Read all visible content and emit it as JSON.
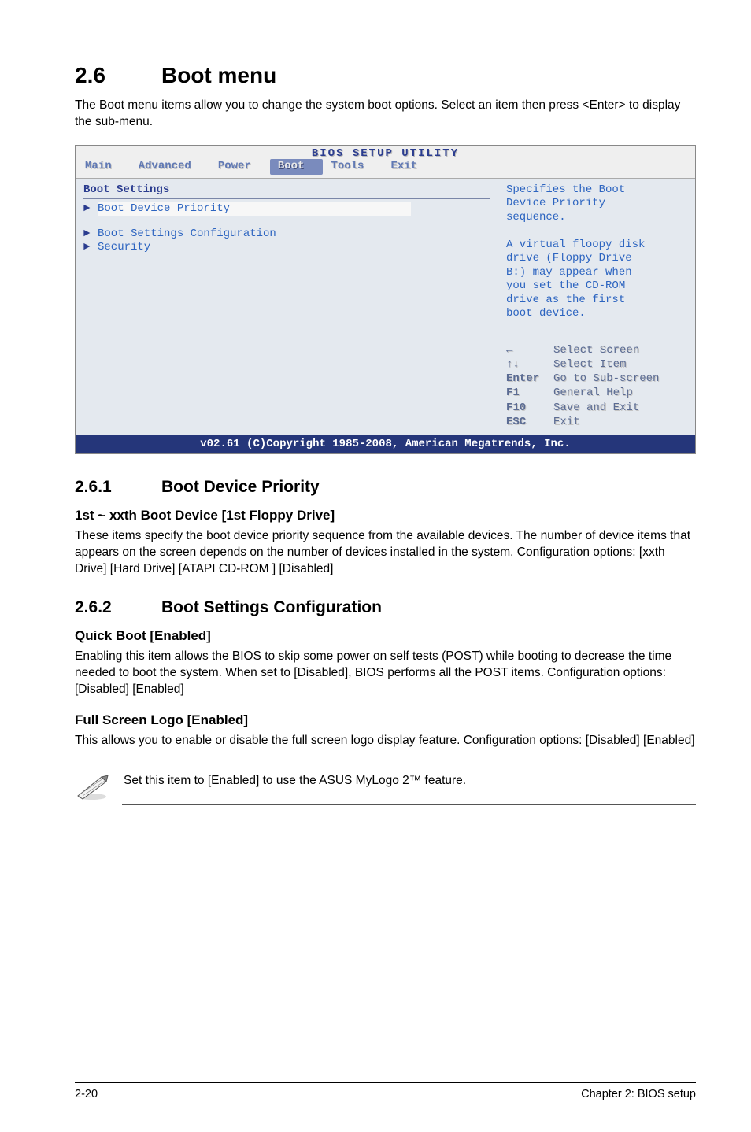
{
  "section": {
    "number": "2.6",
    "title": "Boot menu",
    "intro": "The Boot menu items allow you to change the system boot options. Select an item then press <Enter> to display the sub-menu."
  },
  "bios": {
    "utility_title": "BIOS SETUP UTILITY",
    "tabs": {
      "main": "Main",
      "advanced": "Advanced",
      "power": "Power",
      "boot": "Boot",
      "tools": "Tools",
      "exit": "Exit"
    },
    "left_heading": "Boot Settings",
    "items": {
      "boot_device_priority": "Boot Device Priority",
      "boot_settings_config": "Boot Settings Configuration",
      "security": "Security"
    },
    "help": {
      "line1": "Specifies the Boot",
      "line2": "Device Priority",
      "line3": "sequence.",
      "blank": "",
      "line4": "A virtual floopy disk",
      "line5": "drive (Floppy Drive",
      "line6": "B:) may appear when",
      "line7": "you set the CD-ROM",
      "line8": "drive as the first",
      "line9": "boot device."
    },
    "nav": {
      "select_screen_key": "←",
      "select_screen": "Select Screen",
      "select_item_key": "↑↓",
      "select_item": "Select Item",
      "enter_key": "Enter",
      "enter": "Go to Sub-screen",
      "f1_key": "F1",
      "f1": "General Help",
      "f10_key": "F10",
      "f10": "Save and Exit",
      "esc_key": "ESC",
      "esc": "Exit"
    },
    "footer": "v02.61 (C)Copyright 1985-2008, American Megatrends, Inc."
  },
  "sub_261": {
    "number": "2.6.1",
    "title": "Boot Device Priority",
    "opt1_title": "1st ~ xxth Boot Device [1st Floppy Drive]",
    "opt1_body": "These items specify the boot device priority sequence from the available devices. The number of device items that appears on the screen depends on the number of devices installed in the system. Configuration options: [xxth Drive] [Hard Drive] [ATAPI CD-ROM  ] [Disabled]"
  },
  "sub_262": {
    "number": "2.6.2",
    "title": "Boot Settings Configuration",
    "opt1_title": "Quick Boot [Enabled]",
    "opt1_body": "Enabling this item allows the BIOS to skip some power on self tests (POST) while booting to decrease the time needed to boot the system. When set to [Disabled], BIOS performs all the POST items. Configuration options: [Disabled] [Enabled]",
    "opt2_title": "Full Screen Logo [Enabled]",
    "opt2_body": "This allows you to enable or disable the full screen logo display feature. Configuration options: [Disabled] [Enabled]",
    "note": "Set this item to [Enabled] to use the ASUS MyLogo 2™ feature."
  },
  "footer": {
    "page_num": "2-20",
    "chapter": "Chapter 2: BIOS setup"
  }
}
